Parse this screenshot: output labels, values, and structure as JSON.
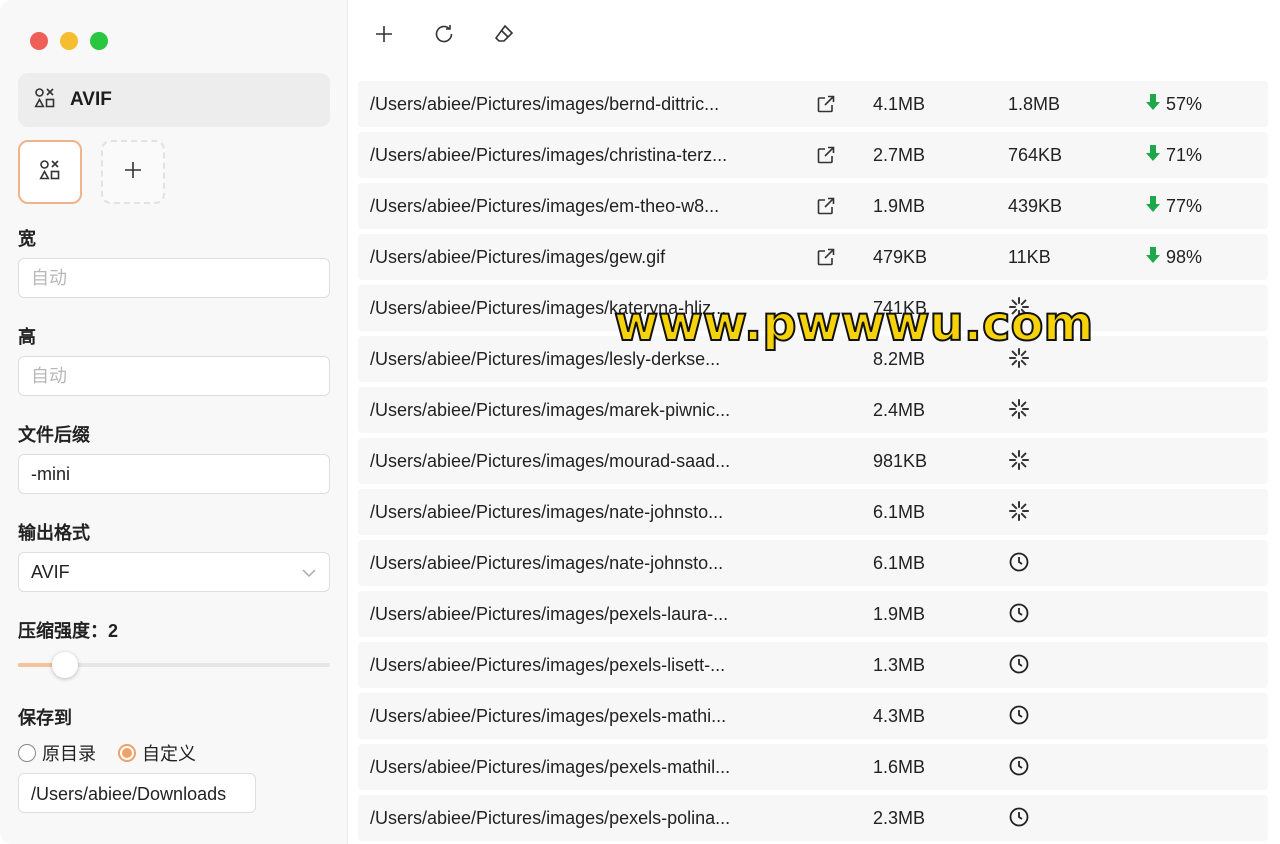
{
  "sidebar": {
    "preset_title": "AVIF",
    "width_label": "宽",
    "width_placeholder": "自动",
    "height_label": "高",
    "height_placeholder": "自动",
    "suffix_label": "文件后缀",
    "suffix_value": "-mini",
    "format_label": "输出格式",
    "format_value": "AVIF",
    "strength_label": "压缩强度：2",
    "strength_fraction": 0.15,
    "save_to_label": "保存到",
    "save_options": [
      "原目录",
      "自定义"
    ],
    "save_selected": "自定义",
    "save_path": "/Users/abiee/Downloads"
  },
  "toolbar": {
    "icons": [
      "plus-icon",
      "refresh-icon",
      "eraser-icon"
    ]
  },
  "files": [
    {
      "path": "/Users/abiee/Pictures/images/bernd-dittric...",
      "orig": "4.1MB",
      "status": "done",
      "new": "1.8MB",
      "saved": "57%"
    },
    {
      "path": "/Users/abiee/Pictures/images/christina-terz...",
      "orig": "2.7MB",
      "status": "done",
      "new": "764KB",
      "saved": "71%"
    },
    {
      "path": "/Users/abiee/Pictures/images/em-theo-w8...",
      "orig": "1.9MB",
      "status": "done",
      "new": "439KB",
      "saved": "77%"
    },
    {
      "path": "/Users/abiee/Pictures/images/gew.gif",
      "orig": "479KB",
      "status": "done",
      "new": "11KB",
      "saved": "98%"
    },
    {
      "path": "/Users/abiee/Pictures/images/kateryna-hliz...",
      "orig": "741KB",
      "status": "processing"
    },
    {
      "path": "/Users/abiee/Pictures/images/lesly-derkse...",
      "orig": "8.2MB",
      "status": "processing"
    },
    {
      "path": "/Users/abiee/Pictures/images/marek-piwnic...",
      "orig": "2.4MB",
      "status": "processing"
    },
    {
      "path": "/Users/abiee/Pictures/images/mourad-saad...",
      "orig": "981KB",
      "status": "processing"
    },
    {
      "path": "/Users/abiee/Pictures/images/nate-johnsto...",
      "orig": "6.1MB",
      "status": "processing"
    },
    {
      "path": "/Users/abiee/Pictures/images/nate-johnsto...",
      "orig": "6.1MB",
      "status": "pending"
    },
    {
      "path": "/Users/abiee/Pictures/images/pexels-laura-...",
      "orig": "1.9MB",
      "status": "pending"
    },
    {
      "path": "/Users/abiee/Pictures/images/pexels-lisett-...",
      "orig": "1.3MB",
      "status": "pending"
    },
    {
      "path": "/Users/abiee/Pictures/images/pexels-mathi...",
      "orig": "4.3MB",
      "status": "pending"
    },
    {
      "path": "/Users/abiee/Pictures/images/pexels-mathil...",
      "orig": "1.6MB",
      "status": "pending"
    },
    {
      "path": "/Users/abiee/Pictures/images/pexels-polina...",
      "orig": "2.3MB",
      "status": "pending"
    }
  ],
  "colors": {
    "accent": "#f0a06a",
    "saved_arrow": "#1fa84a"
  },
  "watermark": "www.pwwwu.com"
}
